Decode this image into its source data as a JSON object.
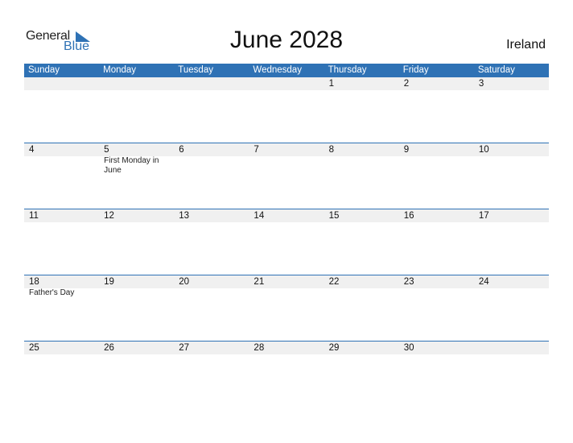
{
  "logo": {
    "general": "General",
    "blue": "Blue"
  },
  "title": "June 2028",
  "country": "Ireland",
  "weekdays": [
    "Sunday",
    "Monday",
    "Tuesday",
    "Wednesday",
    "Thursday",
    "Friday",
    "Saturday"
  ],
  "weeks": [
    {
      "days": [
        "",
        "",
        "",
        "",
        "1",
        "2",
        "3"
      ],
      "events": [
        "",
        "",
        "",
        "",
        "",
        "",
        ""
      ]
    },
    {
      "days": [
        "4",
        "5",
        "6",
        "7",
        "8",
        "9",
        "10"
      ],
      "events": [
        "",
        "First Monday in June",
        "",
        "",
        "",
        "",
        ""
      ]
    },
    {
      "days": [
        "11",
        "12",
        "13",
        "14",
        "15",
        "16",
        "17"
      ],
      "events": [
        "",
        "",
        "",
        "",
        "",
        "",
        ""
      ]
    },
    {
      "days": [
        "18",
        "19",
        "20",
        "21",
        "22",
        "23",
        "24"
      ],
      "events": [
        "Father's Day",
        "",
        "",
        "",
        "",
        "",
        ""
      ]
    },
    {
      "days": [
        "25",
        "26",
        "27",
        "28",
        "29",
        "30",
        ""
      ],
      "events": [
        "",
        "",
        "",
        "",
        "",
        "",
        ""
      ]
    }
  ],
  "colors": {
    "accent": "#2f72b5",
    "day_bar": "#f0f0f0"
  }
}
